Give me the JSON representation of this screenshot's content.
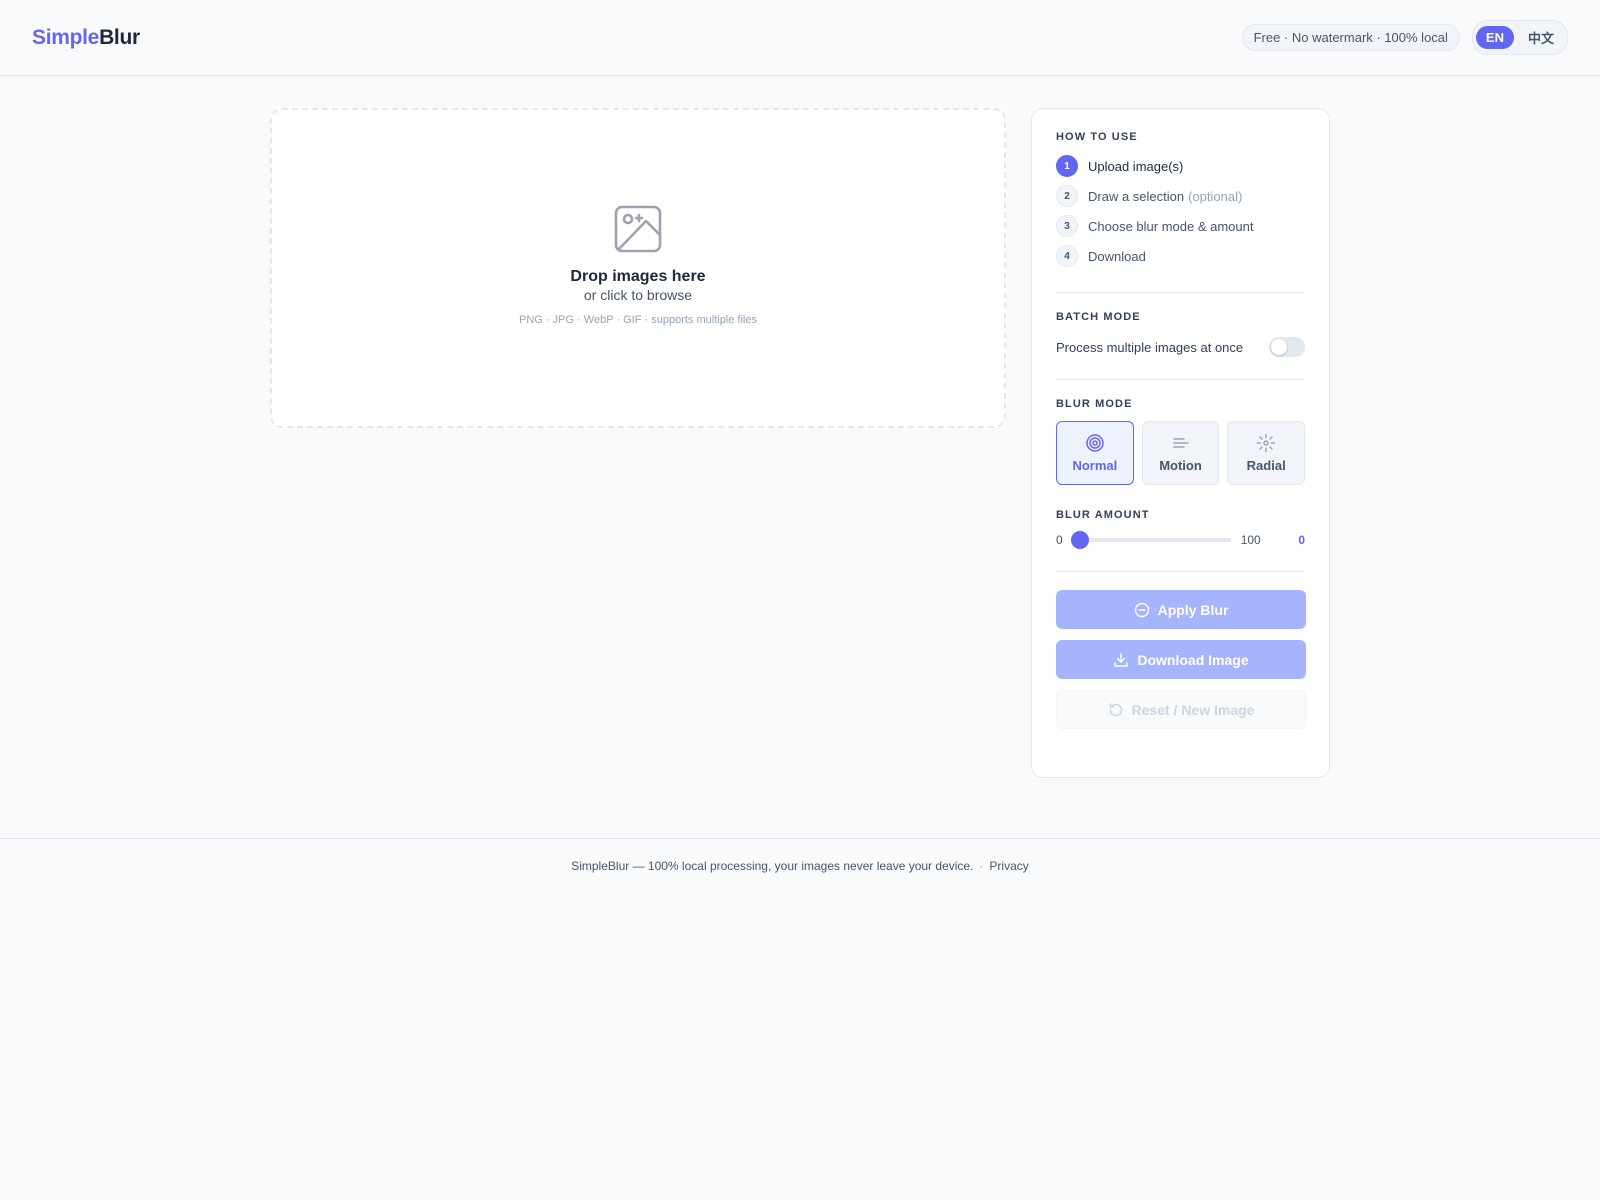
{
  "header": {
    "logo_part1": "Simple",
    "logo_part2": "Blur",
    "badge": "Free · No watermark · 100% local",
    "lang_en": "EN",
    "lang_zh": "中文"
  },
  "dropzone": {
    "icon": "image-icon",
    "title": "Drop images here",
    "subtitle": "or click to browse",
    "formats": "PNG · JPG · WebP · GIF  ·  supports multiple files"
  },
  "how_to_use": {
    "title": "HOW TO USE",
    "steps": [
      {
        "num": "1",
        "label": "Upload image(s)",
        "optional": ""
      },
      {
        "num": "2",
        "label": "Draw a selection",
        "optional": "(optional)"
      },
      {
        "num": "3",
        "label": "Choose blur mode & amount",
        "optional": ""
      },
      {
        "num": "4",
        "label": "Download",
        "optional": ""
      }
    ]
  },
  "batch_mode": {
    "title": "BATCH MODE",
    "label": "Process multiple images at once",
    "enabled": false
  },
  "blur_mode": {
    "title": "BLUR MODE",
    "selected": "Normal",
    "modes": [
      {
        "label": "Normal",
        "icon": "target-icon"
      },
      {
        "label": "Motion",
        "icon": "motion-lines-icon"
      },
      {
        "label": "Radial",
        "icon": "radial-burst-icon"
      }
    ]
  },
  "blur_amount": {
    "title": "BLUR AMOUNT",
    "min": "0",
    "max": "100",
    "value": "0"
  },
  "actions": {
    "apply": "Apply Blur",
    "download": "Download Image",
    "reset": "Reset / New Image"
  },
  "footer": {
    "text": "SimpleBlur — 100% local processing, your images never leave your device.",
    "separator": "·",
    "privacy": "Privacy"
  },
  "colors": {
    "accent": "#6366f1",
    "accent_disabled": "#a5b4fc",
    "background": "#f8fafc",
    "border": "#e2e8f0"
  }
}
